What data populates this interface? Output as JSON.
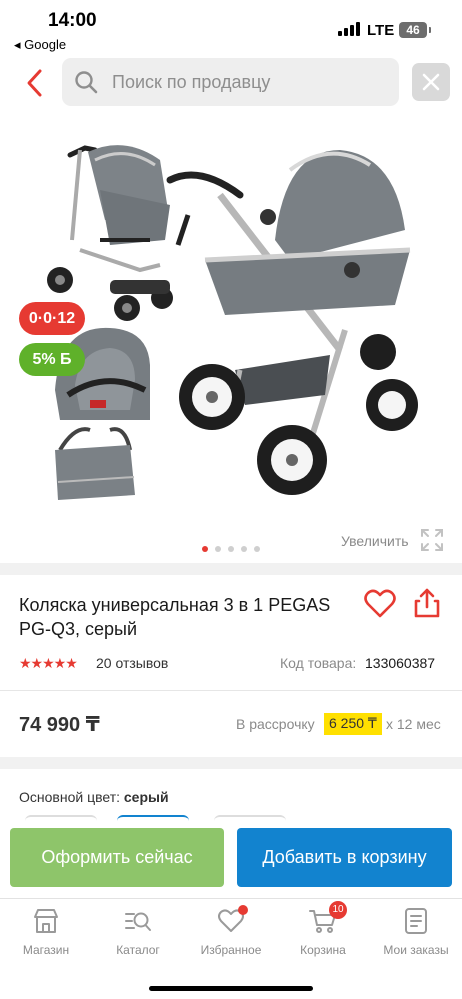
{
  "status_bar": {
    "time": "14:00",
    "back_app": "◂ Google",
    "network": "LTE",
    "battery": "46"
  },
  "search": {
    "placeholder": "Поиск по продавцу"
  },
  "gallery": {
    "badge_installment": "0·0·12",
    "badge_bonus": "5% Б",
    "image_count": 5,
    "active_image": 1,
    "zoom_label": "Увеличить"
  },
  "product": {
    "title": "Коляска универсальная 3 в 1 PEGAS PG-Q3, серый",
    "rating_stars": "★★★★★",
    "reviews": "20 отзывов",
    "code_label": "Код товара:",
    "code_value": "133060387",
    "price": "74 990 ₸",
    "installment_label": "В рассрочку",
    "installment_value": "6 250 ₸",
    "installment_term": "x 12 мес",
    "color_label": "Основной цвет:",
    "color_value": "серый"
  },
  "actions": {
    "checkout": "Оформить сейчас",
    "add_to_cart": "Добавить в корзину"
  },
  "tabbar": {
    "items": [
      {
        "label": "Магазин",
        "icon": "store-icon"
      },
      {
        "label": "Каталог",
        "icon": "catalog-search-icon"
      },
      {
        "label": "Избранное",
        "icon": "heart-icon"
      },
      {
        "label": "Корзина",
        "icon": "cart-icon",
        "badge": "10"
      },
      {
        "label": "Мои заказы",
        "icon": "orders-icon"
      }
    ]
  },
  "colors": {
    "accent_red": "#e63a32",
    "green": "#8ec56a",
    "blue": "#1283cf",
    "highlight_yellow": "#ffe000"
  }
}
